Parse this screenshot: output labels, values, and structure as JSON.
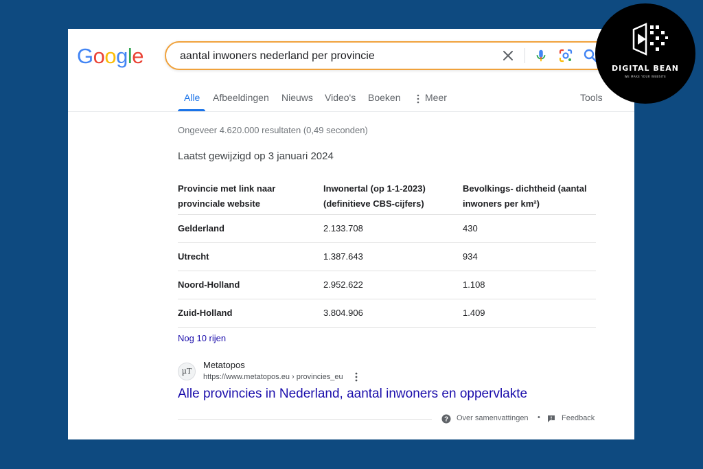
{
  "search": {
    "logo": "Google",
    "logo_colors": [
      "#4285f4",
      "#ea4335",
      "#fbbc05",
      "#4285f4",
      "#34a853",
      "#ea4335"
    ],
    "query": "aantal inwoners nederland per provincie",
    "accent": "#f0a23c"
  },
  "tabs": [
    {
      "label": "Alle",
      "active": true
    },
    {
      "label": "Afbeeldingen"
    },
    {
      "label": "Nieuws"
    },
    {
      "label": "Video's"
    },
    {
      "label": "Boeken"
    },
    {
      "label": "Meer"
    }
  ],
  "tools_label": "Tools",
  "result_stats": "Ongeveer 4.620.000 resultaten (0,49 seconden)",
  "snippet": {
    "modified": "Laatst gewijzigd op 3 januari 2024",
    "headers": [
      "Provincie met link naar provinciale website",
      "Inwonertal (op 1-1-2023) (definitieve CBS-cijfers)",
      "Bevolkings- dichtheid (aantal inwoners per km²)"
    ],
    "rows": [
      [
        "Gelderland",
        "2.133.708",
        "430"
      ],
      [
        "Utrecht",
        "1.387.643",
        "934"
      ],
      [
        "Noord-Holland",
        "2.952.622",
        "1.108"
      ],
      [
        "Zuid-Holland",
        "3.804.906",
        "1.409"
      ]
    ],
    "more_rows": "Nog 10 rijen"
  },
  "source": {
    "favicon_text": "µT",
    "name": "Metatopos",
    "url": "https://www.metatopos.eu › provincies_eu",
    "title": "Alle provincies in Nederland, aantal inwoners en oppervlakte"
  },
  "footer": {
    "about": "Over samenvattingen",
    "separator": "•",
    "feedback": "Feedback"
  },
  "badge": {
    "title": "DIGITAL BEAN",
    "subtitle": "WE MAKE YOUR WEBSITE"
  },
  "colors": {
    "background": "#0e4a80",
    "link": "#1a0dab",
    "active_tab": "#1a73e8"
  }
}
